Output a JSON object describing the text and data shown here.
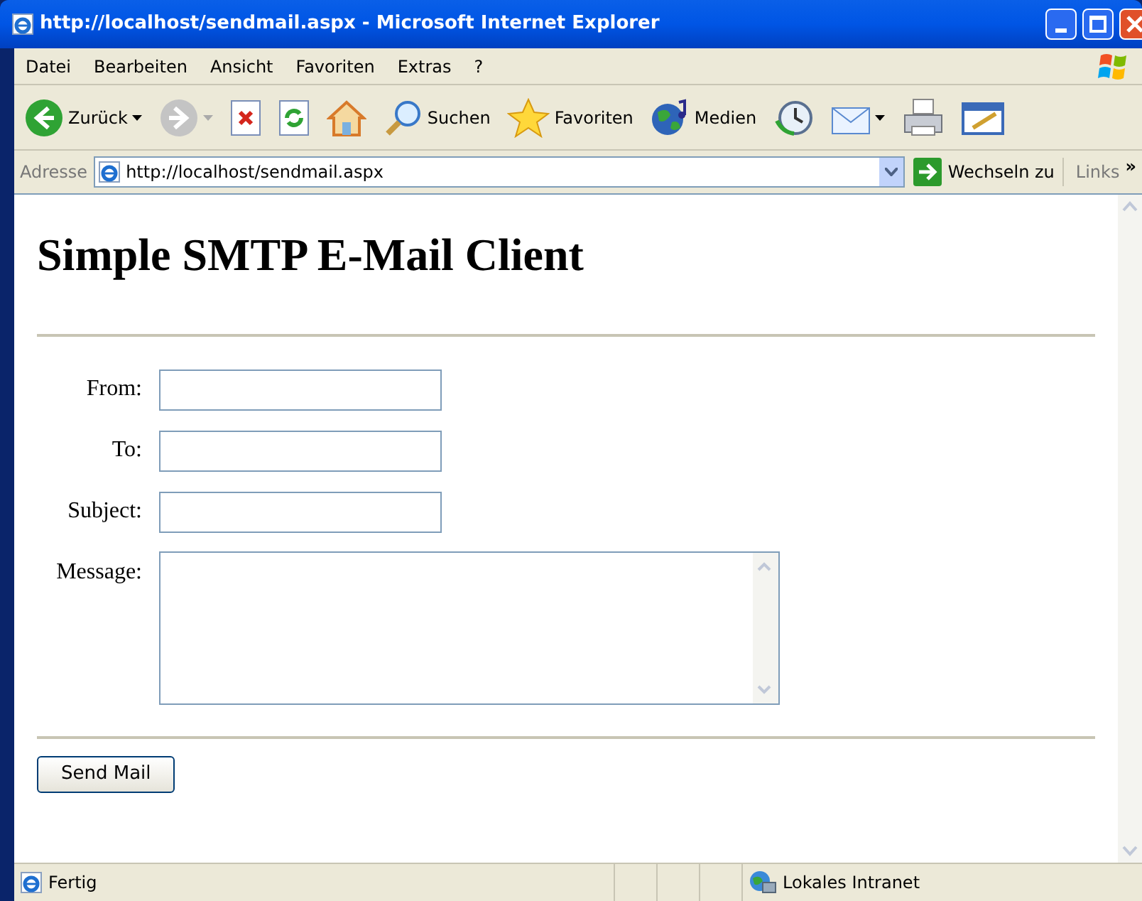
{
  "window": {
    "title": "http://localhost/sendmail.aspx - Microsoft Internet Explorer"
  },
  "menu": [
    "Datei",
    "Bearbeiten",
    "Ansicht",
    "Favoriten",
    "Extras",
    "?"
  ],
  "toolbar": [
    {
      "kind": "back",
      "label": "Zurück",
      "dropdown": true
    },
    {
      "kind": "forward",
      "dropdown": true
    },
    {
      "kind": "stop"
    },
    {
      "kind": "refresh"
    },
    {
      "kind": "home"
    },
    {
      "kind": "search",
      "label": "Suchen"
    },
    {
      "kind": "favorites",
      "label": "Favoriten"
    },
    {
      "kind": "media",
      "label": "Medien"
    },
    {
      "kind": "history"
    },
    {
      "kind": "mail",
      "dropdown": true
    },
    {
      "kind": "print"
    },
    {
      "kind": "edit"
    }
  ],
  "address": {
    "label": "Adresse",
    "value": "http://localhost/sendmail.aspx",
    "go": "Wechseln zu",
    "links": "Links",
    "more": "»"
  },
  "page": {
    "heading": "Simple SMTP E-Mail Client",
    "fields": [
      {
        "label": "From:",
        "kind": "input"
      },
      {
        "label": "To:",
        "kind": "input"
      },
      {
        "label": "Subject:",
        "kind": "input"
      },
      {
        "label": "Message:",
        "kind": "textarea"
      }
    ],
    "button": "Send Mail"
  },
  "status_bar": {
    "text": "Fertig",
    "zone": "Lokales Intranet"
  }
}
